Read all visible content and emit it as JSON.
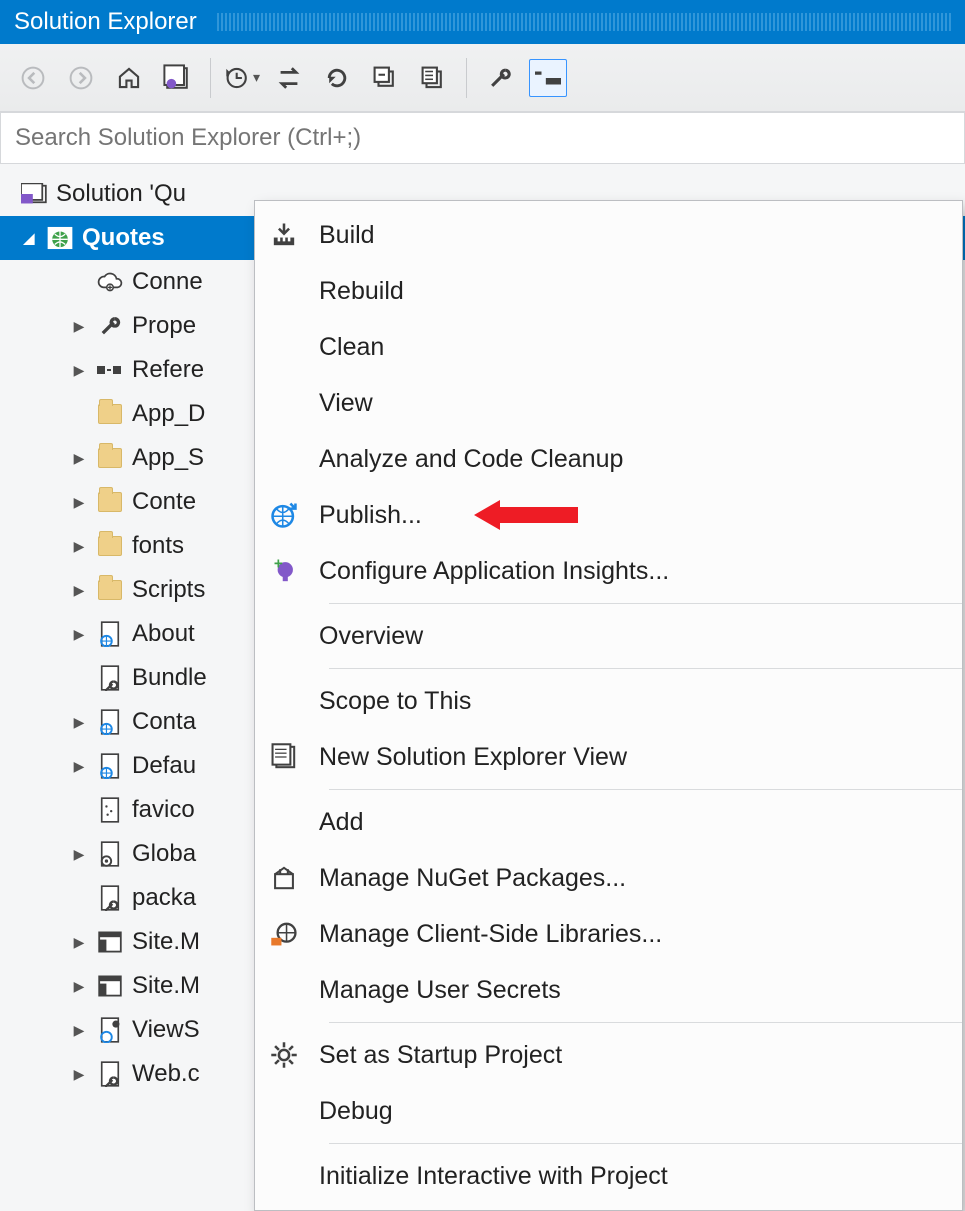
{
  "panel": {
    "title": "Solution Explorer"
  },
  "search": {
    "placeholder": "Search Solution Explorer (Ctrl+;)"
  },
  "tree": {
    "solution": "Solution 'Qu",
    "project": "Quotes",
    "items": [
      {
        "label": "Conne",
        "icon": "cloud",
        "expand": ""
      },
      {
        "label": "Prope",
        "icon": "wrench",
        "expand": "▶"
      },
      {
        "label": "Refere",
        "icon": "ref",
        "expand": "▶"
      },
      {
        "label": "App_D",
        "icon": "folder",
        "expand": ""
      },
      {
        "label": "App_S",
        "icon": "folder",
        "expand": "▶"
      },
      {
        "label": "Conte",
        "icon": "folder",
        "expand": "▶"
      },
      {
        "label": "fonts",
        "icon": "folder",
        "expand": "▶"
      },
      {
        "label": "Scripts",
        "icon": "folder",
        "expand": "▶"
      },
      {
        "label": "About",
        "icon": "aspx",
        "expand": "▶"
      },
      {
        "label": "Bundle",
        "icon": "config",
        "expand": ""
      },
      {
        "label": "Conta",
        "icon": "aspx",
        "expand": "▶"
      },
      {
        "label": "Defau",
        "icon": "aspx",
        "expand": "▶"
      },
      {
        "label": "favico",
        "icon": "file",
        "expand": ""
      },
      {
        "label": "Globa",
        "icon": "gear-file",
        "expand": "▶"
      },
      {
        "label": "packa",
        "icon": "config",
        "expand": ""
      },
      {
        "label": "Site.M",
        "icon": "master",
        "expand": "▶"
      },
      {
        "label": "Site.M",
        "icon": "master",
        "expand": "▶"
      },
      {
        "label": "ViewS",
        "icon": "aspx-user",
        "expand": "▶"
      },
      {
        "label": "Web.c",
        "icon": "config",
        "expand": "▶"
      }
    ]
  },
  "context_menu": {
    "items": [
      {
        "label": "Build",
        "icon": "build",
        "sep": false
      },
      {
        "label": "Rebuild",
        "icon": "",
        "sep": false
      },
      {
        "label": "Clean",
        "icon": "",
        "sep": false
      },
      {
        "label": "View",
        "icon": "",
        "sep": false
      },
      {
        "label": "Analyze and Code Cleanup",
        "icon": "",
        "sep": false
      },
      {
        "label": "Publish...",
        "icon": "publish",
        "sep": false,
        "arrow": true
      },
      {
        "label": "Configure Application Insights...",
        "icon": "bulb",
        "sep": true
      },
      {
        "label": "Overview",
        "icon": "",
        "sep": true
      },
      {
        "label": "Scope to This",
        "icon": "",
        "sep": false
      },
      {
        "label": "New Solution Explorer View",
        "icon": "newview",
        "sep": true
      },
      {
        "label": "Add",
        "icon": "",
        "sep": false
      },
      {
        "label": "Manage NuGet Packages...",
        "icon": "nuget",
        "sep": false
      },
      {
        "label": "Manage Client-Side Libraries...",
        "icon": "clientlib",
        "sep": false
      },
      {
        "label": "Manage User Secrets",
        "icon": "",
        "sep": true
      },
      {
        "label": "Set as Startup Project",
        "icon": "gear",
        "sep": false
      },
      {
        "label": "Debug",
        "icon": "",
        "sep": true
      },
      {
        "label": "Initialize Interactive with Project",
        "icon": "",
        "sep": false
      }
    ]
  }
}
